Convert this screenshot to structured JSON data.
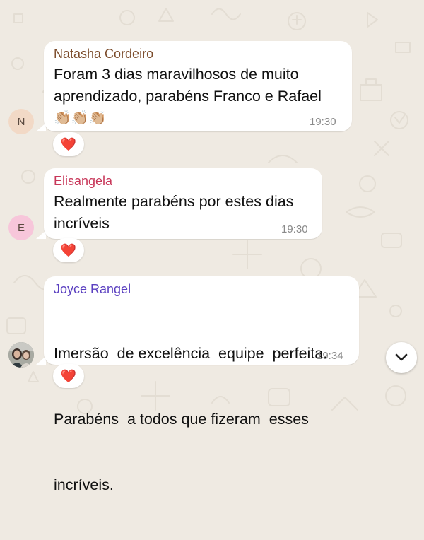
{
  "chat": {
    "background": "#efeae2",
    "messages": [
      {
        "sender": "Natasha Cordeiro",
        "sender_color": "#7b4b2a",
        "avatar_initial": "N",
        "avatar_color": "#f2d9c6",
        "lines": [
          "Foram 3 dias maravilhosos de muito",
          "aprendizado, parabéns Franco e Rafael"
        ],
        "emoji_line": "👏🏼👏🏼👏🏼",
        "time": "19:30",
        "reaction": "❤️"
      },
      {
        "sender": "Elisangela",
        "sender_color": "#c8385a",
        "avatar_initial": "E",
        "avatar_color": "#f7c6da",
        "lines": [
          "Realmente parabéns por estes dias",
          "incríveis"
        ],
        "time": "19:30",
        "reaction": "❤️"
      },
      {
        "sender": "Joyce Rangel",
        "sender_color": "#5a3fc0",
        "avatar_type": "photo",
        "lines": [
          "Imersão  de excelência  equipe  perfeita.",
          "Parabéns  a todos que fizeram  esses",
          "incríveis."
        ],
        "time": "19:34",
        "reaction": "❤️"
      }
    ],
    "scroll_button_icon": "chevron-down-icon"
  }
}
